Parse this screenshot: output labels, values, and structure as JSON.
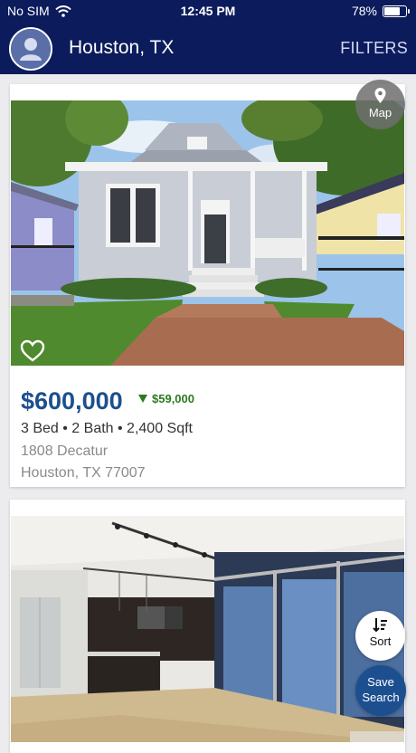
{
  "status_bar": {
    "carrier": "No SIM",
    "time": "12:45 PM",
    "battery": "78%",
    "battery_level": 0.78
  },
  "nav": {
    "title": "Houston, TX",
    "filters_label": "FILTERS"
  },
  "buttons": {
    "map_label": "Map",
    "sort_label": "Sort",
    "save_search_line1": "Save",
    "save_search_line2": "Search"
  },
  "listings": [
    {
      "price": "$600,000",
      "price_change": "$59,000",
      "specs": "3 Bed • 2 Bath • 2,400 Sqft",
      "address_line1": "1808 Decatur",
      "address_line2": "Houston, TX 77007"
    },
    {}
  ],
  "colors": {
    "brand_navy": "#0b1b5c",
    "price_blue": "#1c4f8f",
    "price_drop_green": "#2d7a1f"
  },
  "icons": [
    "wifi-icon",
    "battery-icon",
    "user-avatar-icon",
    "map-pin-icon",
    "heart-icon",
    "sort-icon"
  ]
}
